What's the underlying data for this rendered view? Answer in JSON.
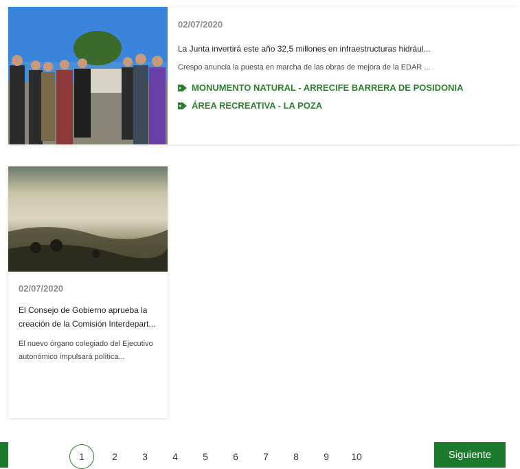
{
  "colors": {
    "accent": "#1b7a2c",
    "tag": "#2e7d32",
    "date": "#8a8a8a"
  },
  "cards": [
    {
      "date": "02/07/2020",
      "title": "La Junta invertirá este año 32,5 millones en infraestructuras hidrául...",
      "summary": "Crespo anuncia la puesta en marcha de las obras de mejora de la EDAR ...",
      "tags": [
        {
          "icon": "tag-icon",
          "label": "Monumento Natural - Arrecife Barrera de Posidonia"
        },
        {
          "icon": "tag-icon",
          "label": "Área Recreativa - La Poza"
        }
      ]
    },
    {
      "date": "02/07/2020",
      "title": "El Consejo de Gobierno aprueba la creación de la Comisión Interdepart...",
      "summary": "El nuevo órgano colegiado del Ejecutivo autonómico impulsará política..."
    }
  ],
  "pagination": {
    "current": "1",
    "pages": [
      "2",
      "3",
      "4",
      "5",
      "6",
      "7",
      "8",
      "9",
      "10"
    ],
    "next_label": "Siguiente"
  }
}
